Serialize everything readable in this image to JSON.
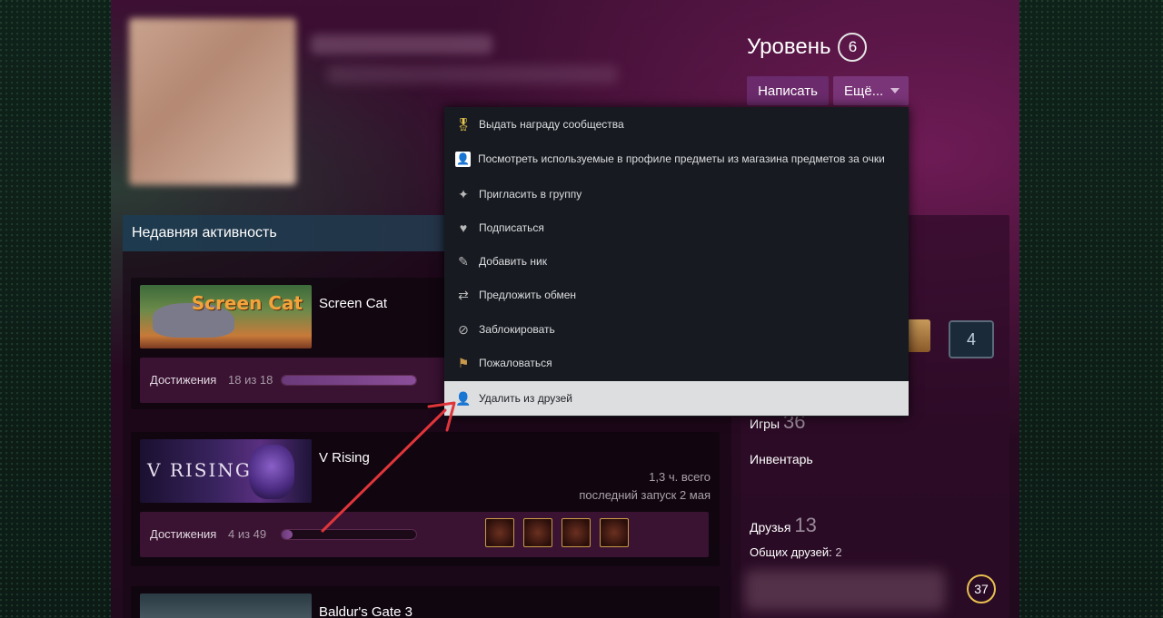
{
  "profile": {
    "level_label": "Уровень",
    "level_value": "6",
    "write_button": "Написать",
    "more_button": "Ещё..."
  },
  "dropdown": {
    "items": [
      {
        "label": "Выдать награду сообщества",
        "icon": "award-icon"
      },
      {
        "label": "Посмотреть используемые в профиле предметы из магазина предметов за очки",
        "icon": "profile-items-icon"
      },
      {
        "label": "Пригласить в группу",
        "icon": "group-invite-icon"
      },
      {
        "label": "Подписаться",
        "icon": "heart-icon"
      },
      {
        "label": "Добавить ник",
        "icon": "pencil-icon"
      },
      {
        "label": "Предложить обмен",
        "icon": "trade-icon"
      },
      {
        "label": "Заблокировать",
        "icon": "block-icon"
      },
      {
        "label": "Пожаловаться",
        "icon": "flag-icon"
      },
      {
        "label": "Удалить из друзей",
        "icon": "remove-friend-icon"
      }
    ],
    "highlighted_index": 8
  },
  "activity": {
    "header": "Недавняя активность",
    "games": [
      {
        "name": "Screen Cat",
        "capsule_title": "Screen Cat",
        "achievements_label": "Достижения",
        "achievements_count": "18 из 18",
        "progress": 1.0
      },
      {
        "name": "V Rising",
        "capsule_title": "RISING",
        "hours": "1,3 ч. всего",
        "last_played": "последний запуск 2 мая",
        "achievements_label": "Достижения",
        "achievements_count": "4 из 49",
        "progress": 0.08
      },
      {
        "name": "Baldur's Gate 3"
      }
    ]
  },
  "sidebar": {
    "badge_number": "4",
    "games_label": "Игры",
    "games_count": "36",
    "inventory_label": "Инвентарь",
    "friends_label": "Друзья",
    "friends_count": "13",
    "mutual_label": "Общих друзей:",
    "mutual_count": "2",
    "friend_level": "37"
  },
  "colors": {
    "menu_bg": "#171a21",
    "menu_highlight": "#dcdedf",
    "button_purple": "#6a2a6b",
    "arrow_red": "#e0353a"
  }
}
